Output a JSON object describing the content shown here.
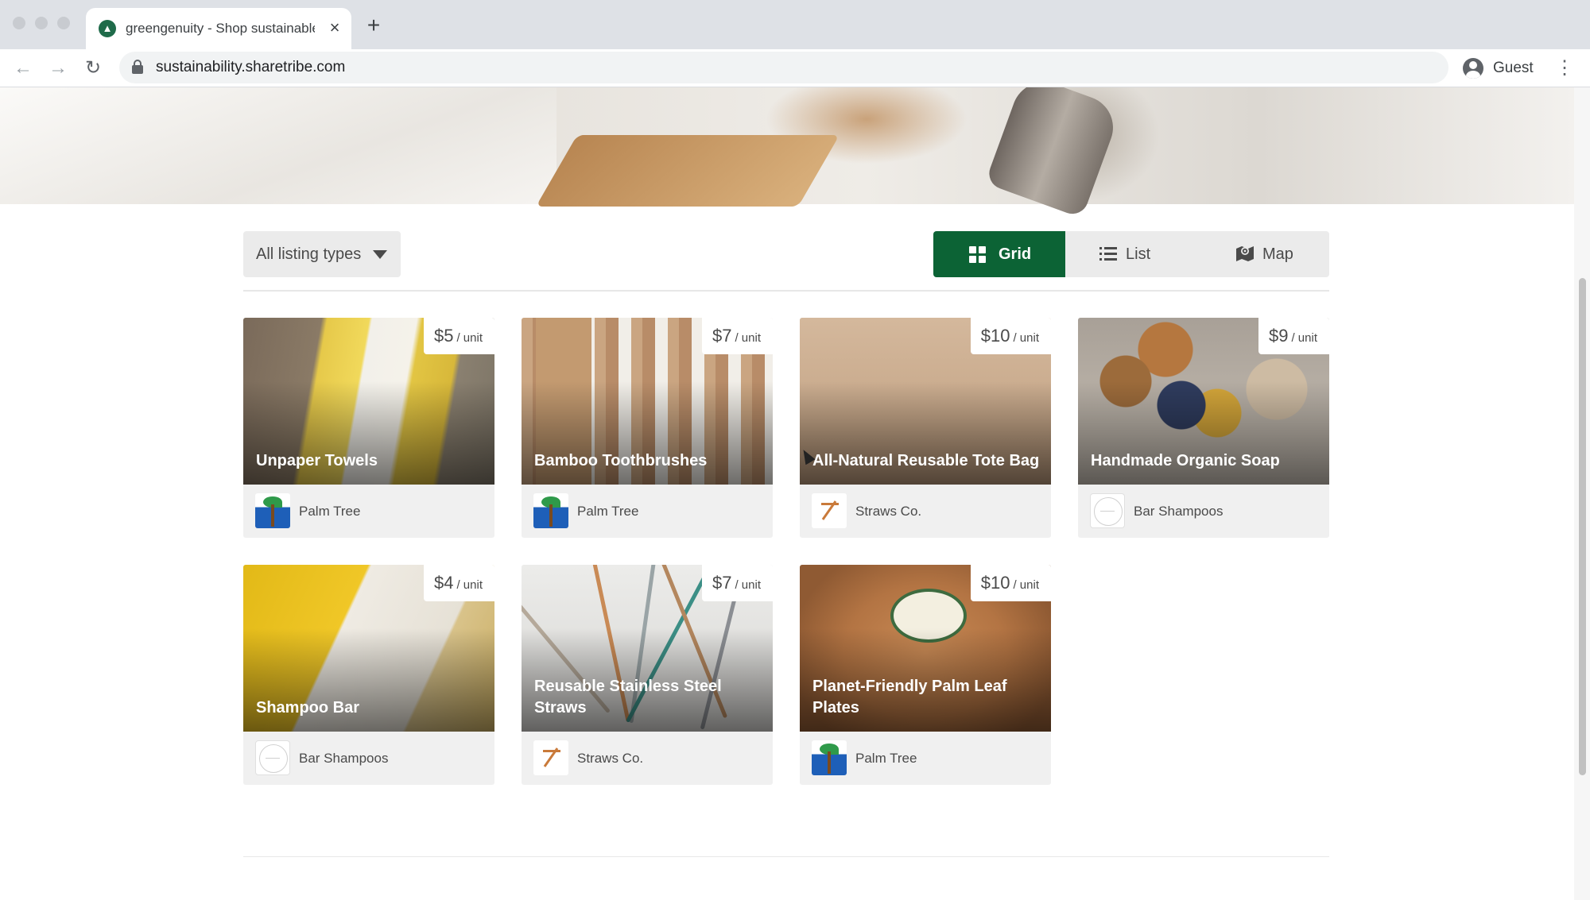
{
  "browser": {
    "tab_title": "greengenuity - Shop sustainable",
    "tab_close": "×",
    "new_tab": "+",
    "url": "sustainability.sharetribe.com",
    "profile_label": "Guest",
    "back": "←",
    "forward": "→",
    "reload": "↻",
    "menu": "⋮"
  },
  "filters": {
    "listing_type": "All listing types"
  },
  "view_toggle": {
    "grid": "Grid",
    "list": "List",
    "map": "Map",
    "active": "grid"
  },
  "listings": [
    {
      "title": "Unpaper Towels",
      "price": "$5",
      "unit": "/ unit",
      "author": "Palm Tree"
    },
    {
      "title": "Bamboo Toothbrushes",
      "price": "$7",
      "unit": "/ unit",
      "author": "Palm Tree"
    },
    {
      "title": "All-Natural Reusable Tote Bag",
      "price": "$10",
      "unit": "/ unit",
      "author": "Straws Co."
    },
    {
      "title": "Handmade Organic Soap",
      "price": "$9",
      "unit": "/ unit",
      "author": "Bar Shampoos"
    },
    {
      "title": "Shampoo Bar",
      "price": "$4",
      "unit": "/ unit",
      "author": "Bar Shampoos"
    },
    {
      "title": "Reusable Stainless Steel Straws",
      "price": "$7",
      "unit": "/ unit",
      "author": "Straws Co."
    },
    {
      "title": "Planet-Friendly Palm Leaf Plates",
      "price": "$10",
      "unit": "/ unit",
      "author": "Palm Tree"
    }
  ],
  "colors": {
    "accent": "#0c6335",
    "card_bg": "#f0f0f0",
    "toggle_bg": "#ebebeb"
  }
}
